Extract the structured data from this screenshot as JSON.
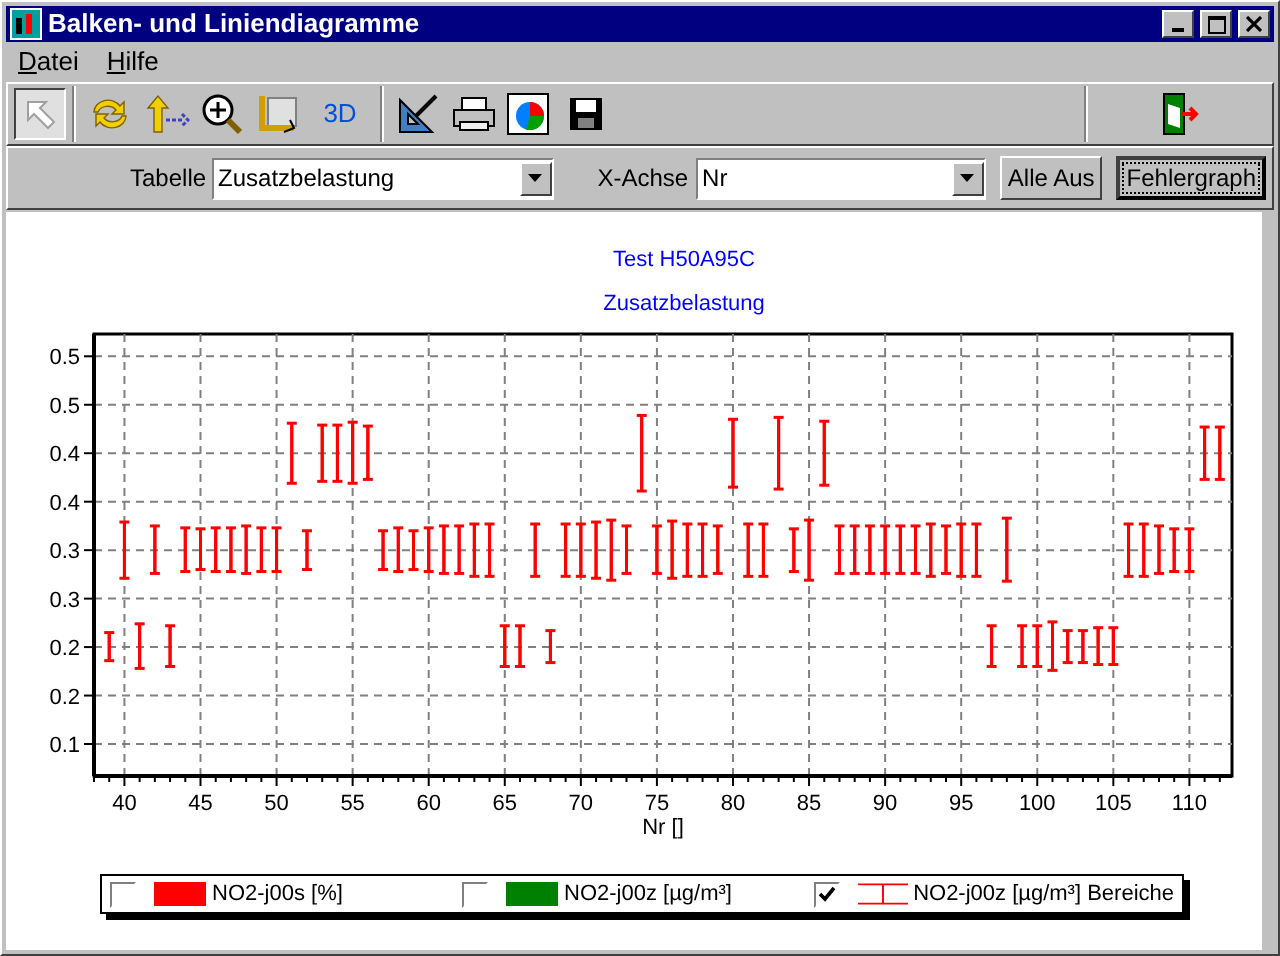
{
  "window": {
    "title": "Balken- und Liniendiagramme"
  },
  "menu": [
    {
      "label": "Datei"
    },
    {
      "label": "Hilfe"
    }
  ],
  "toolbar": {
    "pointer_tool": {
      "selected": true
    },
    "view_3d": {
      "label": "3D"
    }
  },
  "filter": {
    "table_label": "Tabelle",
    "table_value": "Zusatzbelastung",
    "xaxis_label": "X-Achse",
    "xaxis_value": "Nr"
  },
  "buttons": [
    {
      "label": "Alle Aus",
      "focused": false
    },
    {
      "label": "Fehlergraph",
      "focused": true
    }
  ],
  "chart": {
    "subtitle": "Zusatzbelastung",
    "chart_data": {
      "type": "candlestick",
      "title": "Test H50A95C",
      "xlabel": "Nr []",
      "x": [
        39,
        40,
        41,
        42,
        43,
        44,
        45,
        46,
        47,
        48,
        49,
        50,
        51,
        52,
        53,
        54,
        55,
        56,
        57,
        58,
        59,
        60,
        61,
        62,
        63,
        64,
        65,
        66,
        67,
        68,
        69,
        70,
        71,
        72,
        73,
        74,
        75,
        76,
        77,
        78,
        79,
        80,
        81,
        82,
        83,
        84,
        85,
        86,
        87,
        88,
        89,
        90,
        91,
        92,
        93,
        94,
        95,
        96,
        97,
        98,
        99,
        100,
        101,
        102,
        103,
        104,
        105,
        106,
        107,
        108,
        109,
        110,
        111,
        112
      ],
      "series": [
        {
          "name": "NO2-j00z [µg/m³] Bereiche",
          "color": "#ff0000",
          "ohlc": [
            [
              0.186,
              0.215,
              0.186,
              0.215
            ],
            [
              0.271,
              0.329,
              0.271,
              0.329
            ],
            [
              0.178,
              0.224,
              0.178,
              0.224
            ],
            [
              0.276,
              0.325,
              0.276,
              0.325
            ],
            [
              0.18,
              0.222,
              0.18,
              0.222
            ],
            [
              0.278,
              0.323,
              0.278,
              0.323
            ],
            [
              0.28,
              0.322,
              0.28,
              0.322
            ],
            [
              0.278,
              0.323,
              0.278,
              0.323
            ],
            [
              0.278,
              0.323,
              0.278,
              0.323
            ],
            [
              0.276,
              0.325,
              0.276,
              0.325
            ],
            [
              0.278,
              0.323,
              0.278,
              0.323
            ],
            [
              0.278,
              0.323,
              0.278,
              0.323
            ],
            [
              0.369,
              0.431,
              0.369,
              0.431
            ],
            [
              0.28,
              0.32,
              0.28,
              0.32
            ],
            [
              0.371,
              0.429,
              0.371,
              0.429
            ],
            [
              0.371,
              0.429,
              0.371,
              0.429
            ],
            [
              0.369,
              0.432,
              0.369,
              0.432
            ],
            [
              0.373,
              0.428,
              0.373,
              0.428
            ],
            [
              0.28,
              0.32,
              0.28,
              0.32
            ],
            [
              0.278,
              0.323,
              0.278,
              0.323
            ],
            [
              0.28,
              0.32,
              0.28,
              0.32
            ],
            [
              0.278,
              0.323,
              0.278,
              0.323
            ],
            [
              0.276,
              0.325,
              0.276,
              0.325
            ],
            [
              0.276,
              0.325,
              0.276,
              0.325
            ],
            [
              0.273,
              0.327,
              0.273,
              0.327
            ],
            [
              0.273,
              0.327,
              0.273,
              0.327
            ],
            [
              0.18,
              0.222,
              0.18,
              0.222
            ],
            [
              0.18,
              0.222,
              0.18,
              0.222
            ],
            [
              0.273,
              0.327,
              0.273,
              0.327
            ],
            [
              0.184,
              0.217,
              0.184,
              0.217
            ],
            [
              0.273,
              0.327,
              0.273,
              0.327
            ],
            [
              0.273,
              0.327,
              0.273,
              0.327
            ],
            [
              0.271,
              0.329,
              0.271,
              0.329
            ],
            [
              0.269,
              0.331,
              0.269,
              0.331
            ],
            [
              0.276,
              0.325,
              0.276,
              0.325
            ],
            [
              0.361,
              0.439,
              0.361,
              0.439
            ],
            [
              0.276,
              0.325,
              0.276,
              0.325
            ],
            [
              0.271,
              0.33,
              0.271,
              0.33
            ],
            [
              0.273,
              0.327,
              0.273,
              0.327
            ],
            [
              0.273,
              0.327,
              0.273,
              0.327
            ],
            [
              0.276,
              0.325,
              0.276,
              0.325
            ],
            [
              0.365,
              0.435,
              0.365,
              0.435
            ],
            [
              0.273,
              0.327,
              0.273,
              0.327
            ],
            [
              0.273,
              0.327,
              0.273,
              0.327
            ],
            [
              0.363,
              0.437,
              0.363,
              0.437
            ],
            [
              0.278,
              0.322,
              0.278,
              0.322
            ],
            [
              0.269,
              0.331,
              0.269,
              0.331
            ],
            [
              0.367,
              0.433,
              0.367,
              0.433
            ],
            [
              0.276,
              0.325,
              0.276,
              0.325
            ],
            [
              0.276,
              0.325,
              0.276,
              0.325
            ],
            [
              0.276,
              0.325,
              0.276,
              0.325
            ],
            [
              0.276,
              0.325,
              0.276,
              0.325
            ],
            [
              0.276,
              0.325,
              0.276,
              0.325
            ],
            [
              0.276,
              0.325,
              0.276,
              0.325
            ],
            [
              0.273,
              0.327,
              0.273,
              0.327
            ],
            [
              0.276,
              0.325,
              0.276,
              0.325
            ],
            [
              0.273,
              0.327,
              0.273,
              0.327
            ],
            [
              0.273,
              0.327,
              0.273,
              0.327
            ],
            [
              0.18,
              0.222,
              0.18,
              0.222
            ],
            [
              0.268,
              0.333,
              0.268,
              0.333
            ],
            [
              0.18,
              0.222,
              0.18,
              0.222
            ],
            [
              0.18,
              0.222,
              0.18,
              0.222
            ],
            [
              0.176,
              0.226,
              0.176,
              0.226
            ],
            [
              0.184,
              0.217,
              0.184,
              0.217
            ],
            [
              0.184,
              0.217,
              0.184,
              0.217
            ],
            [
              0.182,
              0.22,
              0.182,
              0.22
            ],
            [
              0.182,
              0.22,
              0.182,
              0.22
            ],
            [
              0.273,
              0.327,
              0.273,
              0.327
            ],
            [
              0.273,
              0.327,
              0.273,
              0.327
            ],
            [
              0.276,
              0.325,
              0.276,
              0.325
            ],
            [
              0.278,
              0.322,
              0.278,
              0.322
            ],
            [
              0.278,
              0.322,
              0.278,
              0.322
            ],
            [
              0.373,
              0.427,
              0.373,
              0.427
            ],
            [
              0.373,
              0.427,
              0.373,
              0.427
            ]
          ]
        }
      ],
      "grid": true,
      "xlim": [
        38,
        112.8
      ],
      "ylim": [
        0.067,
        0.523
      ],
      "xticks": [
        40,
        45,
        50,
        55,
        60,
        65,
        70,
        75,
        80,
        85,
        90,
        95,
        100,
        105,
        110
      ],
      "yticks": [
        {
          "value": 0.1,
          "label": "0.1"
        },
        {
          "value": 0.15,
          "label": "0.2"
        },
        {
          "value": 0.2,
          "label": "0.2"
        },
        {
          "value": 0.25,
          "label": "0.3"
        },
        {
          "value": 0.3,
          "label": "0.3"
        },
        {
          "value": 0.35,
          "label": "0.4"
        },
        {
          "value": 0.4,
          "label": "0.4"
        },
        {
          "value": 0.45,
          "label": "0.5"
        },
        {
          "value": 0.5,
          "label": "0.5"
        }
      ]
    }
  },
  "legend": [
    {
      "kind": "swatch",
      "label": "NO2-j00s [%]",
      "color": "#ff0000",
      "checked": false
    },
    {
      "kind": "swatch",
      "label": "NO2-j00z [µg/m³]",
      "color": "#008000",
      "checked": false
    },
    {
      "kind": "range",
      "color": "#ff0000",
      "checked": true
    }
  ]
}
